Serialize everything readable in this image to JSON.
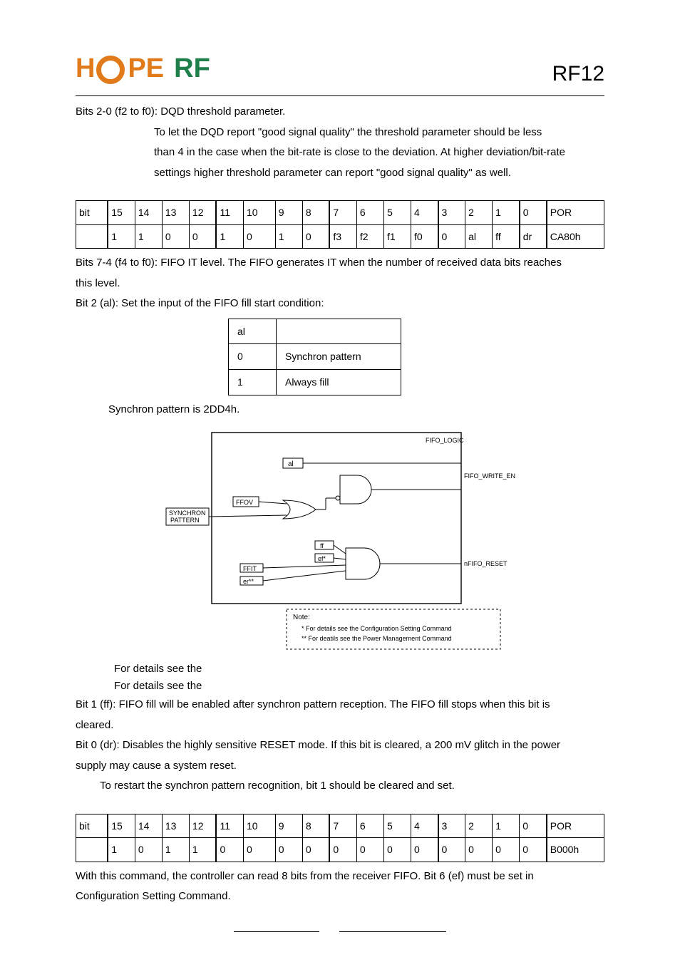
{
  "header": {
    "logo_h": "H",
    "logo_pe": "PE",
    "logo_rf": "RF",
    "product": "RF12"
  },
  "intro": {
    "l1": "Bits 2-0 (f2 to f0): DQD threshold parameter.",
    "l2": "To let the DQD report \"good signal quality\" the threshold parameter should be less",
    "l3": "than 4 in the case when the bit-rate is close to the deviation. At higher deviation/bit-rate",
    "l4": "settings higher threshold parameter can report \"good signal quality\" as well."
  },
  "bits1": {
    "hdr": [
      "bit",
      "15",
      "14",
      "13",
      "12",
      "11",
      "10",
      "9",
      "8",
      "7",
      "6",
      "5",
      "4",
      "3",
      "2",
      "1",
      "0",
      "POR"
    ],
    "row": [
      "",
      "1",
      "1",
      "0",
      "0",
      "1",
      "0",
      "1",
      "0",
      "f3",
      "f2",
      "f1",
      "f0",
      "0",
      "al",
      "ff",
      "dr",
      "CA80h"
    ]
  },
  "after_bits1": {
    "l1": "Bits 7-4 (f4 to f0): FIFO IT level. The FIFO generates IT when the number of received data bits reaches",
    "l2": "this level.",
    "l3": "Bit 2 (al): Set the input of the FIFO fill start condition:"
  },
  "altbl": {
    "r0c0": "al",
    "r0c1": "",
    "r1c0": "0",
    "r1c1": "Synchron pattern",
    "r2c0": "1",
    "r2c1": "Always fill"
  },
  "syn": "Synchron pattern is 2DD4h.",
  "diagram": {
    "fifo_logic": "FIFO_LOGIC",
    "al": "al",
    "fifo_write_en": "FIFO_WRITE_EN",
    "ffov": "FFOV",
    "synchron_pattern_1": "SYNCHRON",
    "synchron_pattern_2": "PATTERN",
    "ff": "ff",
    "ef_star": "ef*",
    "ffit": "FFIT",
    "er_starstar": "er**",
    "nfifo_reset": "nFIFO_RESET",
    "note": "Note:",
    "note_l1": "* For details see the Configuration Setting Command",
    "note_l2": "** For deatils see the Power Management Command"
  },
  "details": {
    "l1": "For details see the",
    "l2": "For details see the"
  },
  "post_diag": {
    "l1": "Bit 1 (ff): FIFO fill will be enabled after synchron pattern reception. The FIFO fill stops when this bit is",
    "l2": "cleared.",
    "l3": "Bit 0 (dr): Disables the highly sensitive RESET mode. If this bit is cleared, a 200 mV glitch in the power",
    "l4": "supply may cause a system reset.",
    "l5": "To restart the synchron pattern recognition, bit 1 should be cleared and set."
  },
  "bits2": {
    "hdr": [
      "bit",
      "15",
      "14",
      "13",
      "12",
      "11",
      "10",
      "9",
      "8",
      "7",
      "6",
      "5",
      "4",
      "3",
      "2",
      "1",
      "0",
      "POR"
    ],
    "row": [
      "",
      "1",
      "0",
      "1",
      "1",
      "0",
      "0",
      "0",
      "0",
      "0",
      "0",
      "0",
      "0",
      "0",
      "0",
      "0",
      "0",
      "B000h"
    ]
  },
  "tail": {
    "l1": "With this command, the controller can read 8 bits from the receiver FIFO. Bit 6 (ef) must be set in",
    "l2": "Configuration Setting Command."
  }
}
